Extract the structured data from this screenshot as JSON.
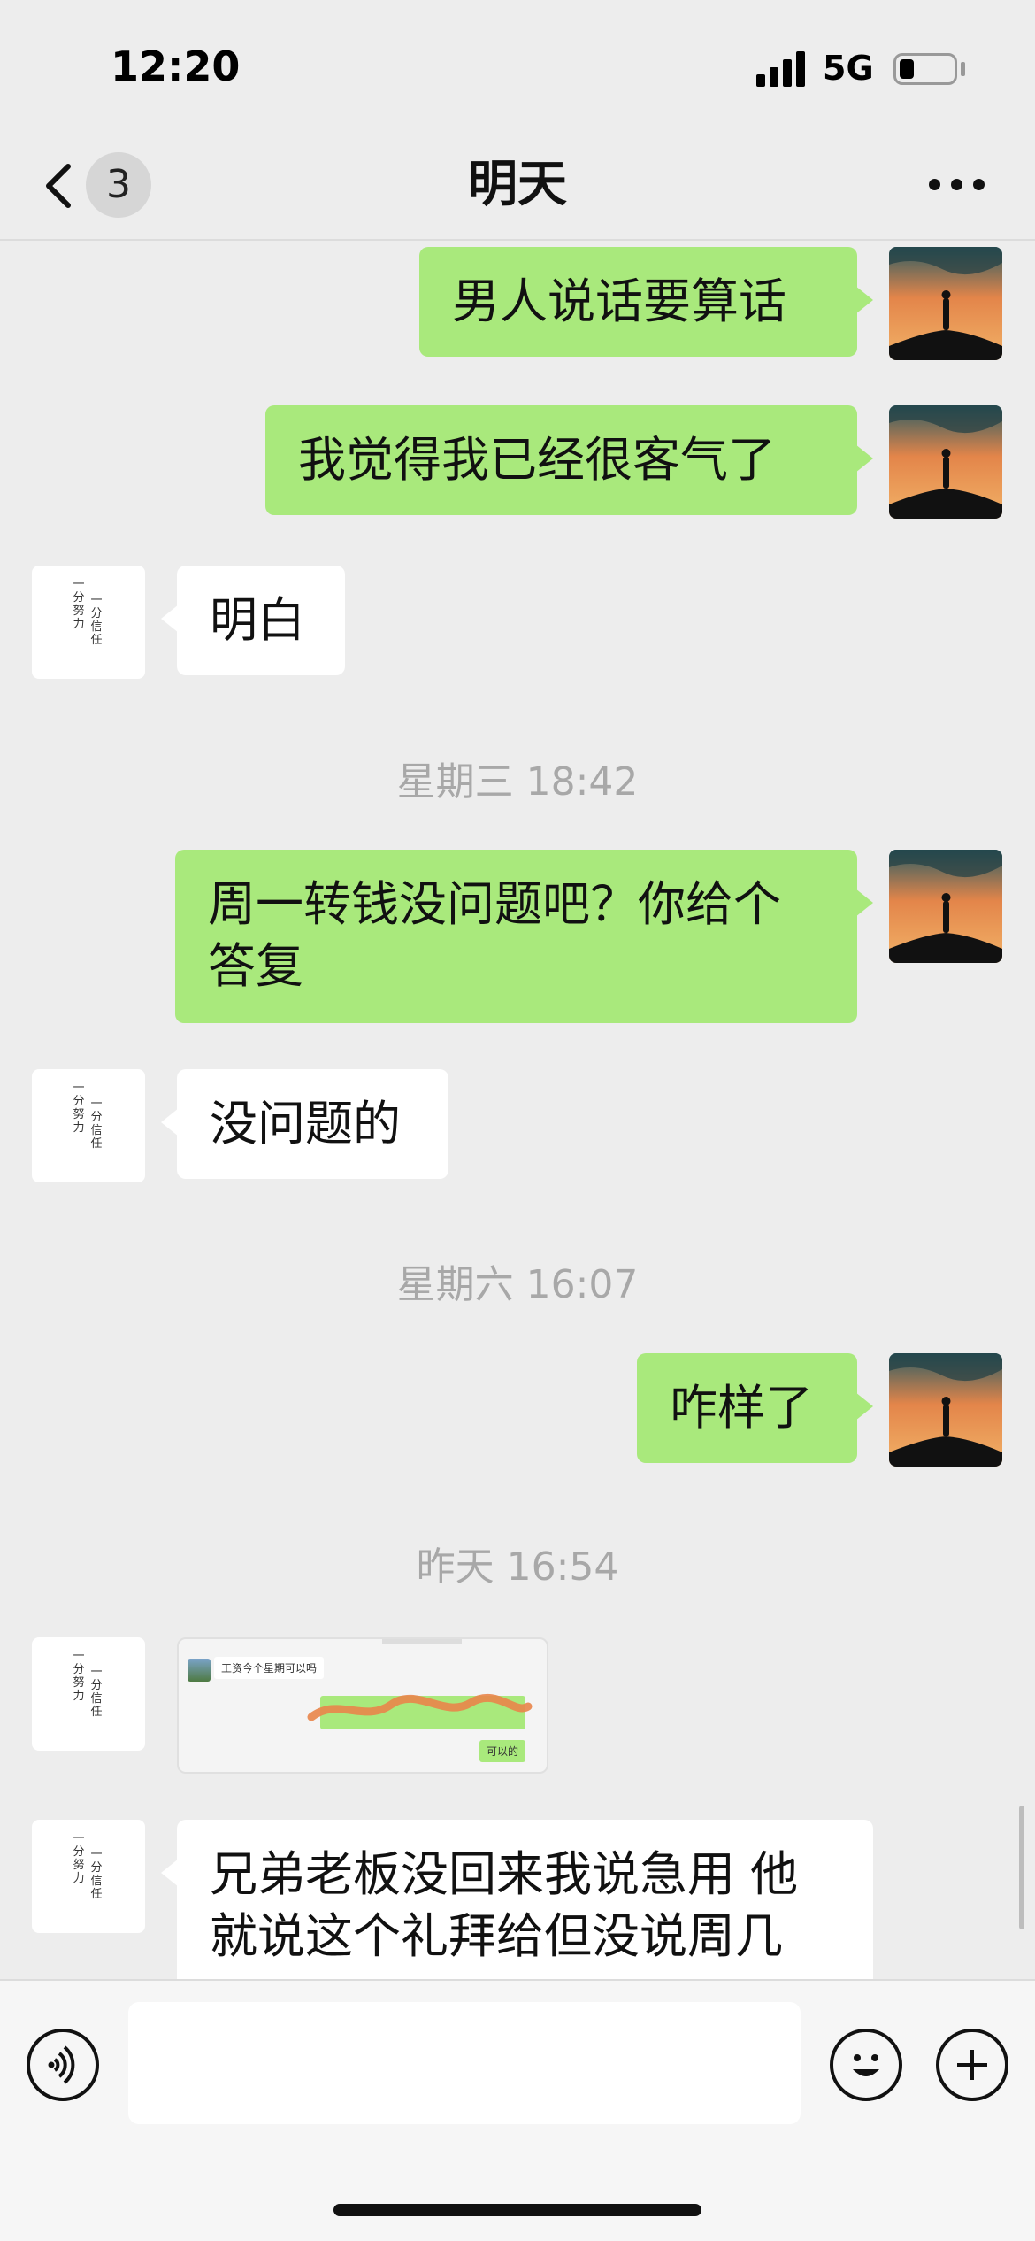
{
  "status_bar": {
    "time": "12:20",
    "network": "5G"
  },
  "nav": {
    "title": "明天",
    "unread_count": "3"
  },
  "messages": [
    {
      "side": "me",
      "text": "男人说话要算话"
    },
    {
      "side": "me",
      "text": "我觉得我已经很客气了"
    },
    {
      "side": "them",
      "text": "明白"
    },
    {
      "timestamp": "星期三 18:42"
    },
    {
      "side": "me",
      "text_line1": "周一转钱没问题吧？你给个",
      "text_line2": "答复"
    },
    {
      "side": "them",
      "text": "没问题的"
    },
    {
      "timestamp": "星期六 16:07"
    },
    {
      "side": "me",
      "text": "咋样了"
    },
    {
      "timestamp": "昨天 16:54"
    },
    {
      "side": "them",
      "type": "image",
      "image_texts": {
        "line1": "工资今个星期可以吗",
        "reply": "可以的"
      }
    },
    {
      "side": "them",
      "text_line1": "兄弟老板没回来我说急用 他",
      "text_line2": "就说这个礼拜给但没说周几"
    }
  ],
  "them_avatar_text": {
    "col1": "一分努力",
    "col2": "一分信任"
  },
  "input": {
    "value": "",
    "placeholder": ""
  },
  "colors": {
    "my_bubble": "#a9e97c",
    "their_bubble": "#ffffff",
    "background": "#ededed"
  },
  "icons": {
    "voice": "voice-icon",
    "emoji": "emoji-icon",
    "plus": "plus-icon",
    "back": "back-chevron-icon",
    "more": "more-icon"
  }
}
